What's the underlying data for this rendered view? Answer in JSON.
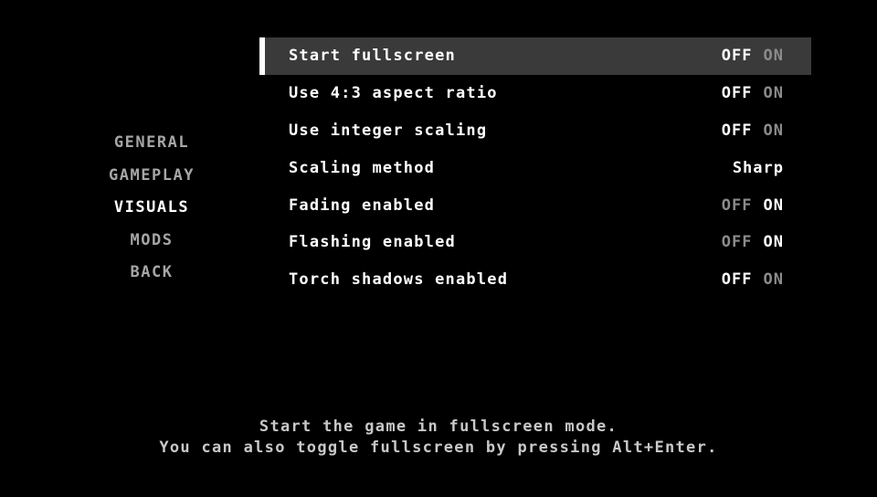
{
  "menu": {
    "items": [
      {
        "label": "GENERAL",
        "active": false
      },
      {
        "label": "GAMEPLAY",
        "active": false
      },
      {
        "label": "VISUALS",
        "active": true
      },
      {
        "label": "MODS",
        "active": false
      },
      {
        "label": "BACK",
        "active": false
      }
    ]
  },
  "options": [
    {
      "label": "Start fullscreen",
      "type": "toggle",
      "off": "OFF",
      "on": "ON",
      "value": "OFF",
      "selected": true
    },
    {
      "label": "Use 4:3 aspect ratio",
      "type": "toggle",
      "off": "OFF",
      "on": "ON",
      "value": "OFF",
      "selected": false
    },
    {
      "label": "Use integer scaling",
      "type": "toggle",
      "off": "OFF",
      "on": "ON",
      "value": "OFF",
      "selected": false
    },
    {
      "label": "Scaling method",
      "type": "choice",
      "value": "Sharp",
      "selected": false
    },
    {
      "label": "Fading enabled",
      "type": "toggle",
      "off": "OFF",
      "on": "ON",
      "value": "ON",
      "selected": false
    },
    {
      "label": "Flashing enabled",
      "type": "toggle",
      "off": "OFF",
      "on": "ON",
      "value": "ON",
      "selected": false
    },
    {
      "label": "Torch shadows enabled",
      "type": "toggle",
      "off": "OFF",
      "on": "ON",
      "value": "OFF",
      "selected": false
    }
  ],
  "description": {
    "line1": "Start the game in fullscreen mode.",
    "line2": "You can also toggle fullscreen by pressing Alt+Enter."
  },
  "colors": {
    "background": "#000000",
    "selected_row": "#3a3a3a",
    "active_text": "#ffffff",
    "dim_text": "#8c8c8c",
    "menu_inactive": "#a6a6a6"
  }
}
